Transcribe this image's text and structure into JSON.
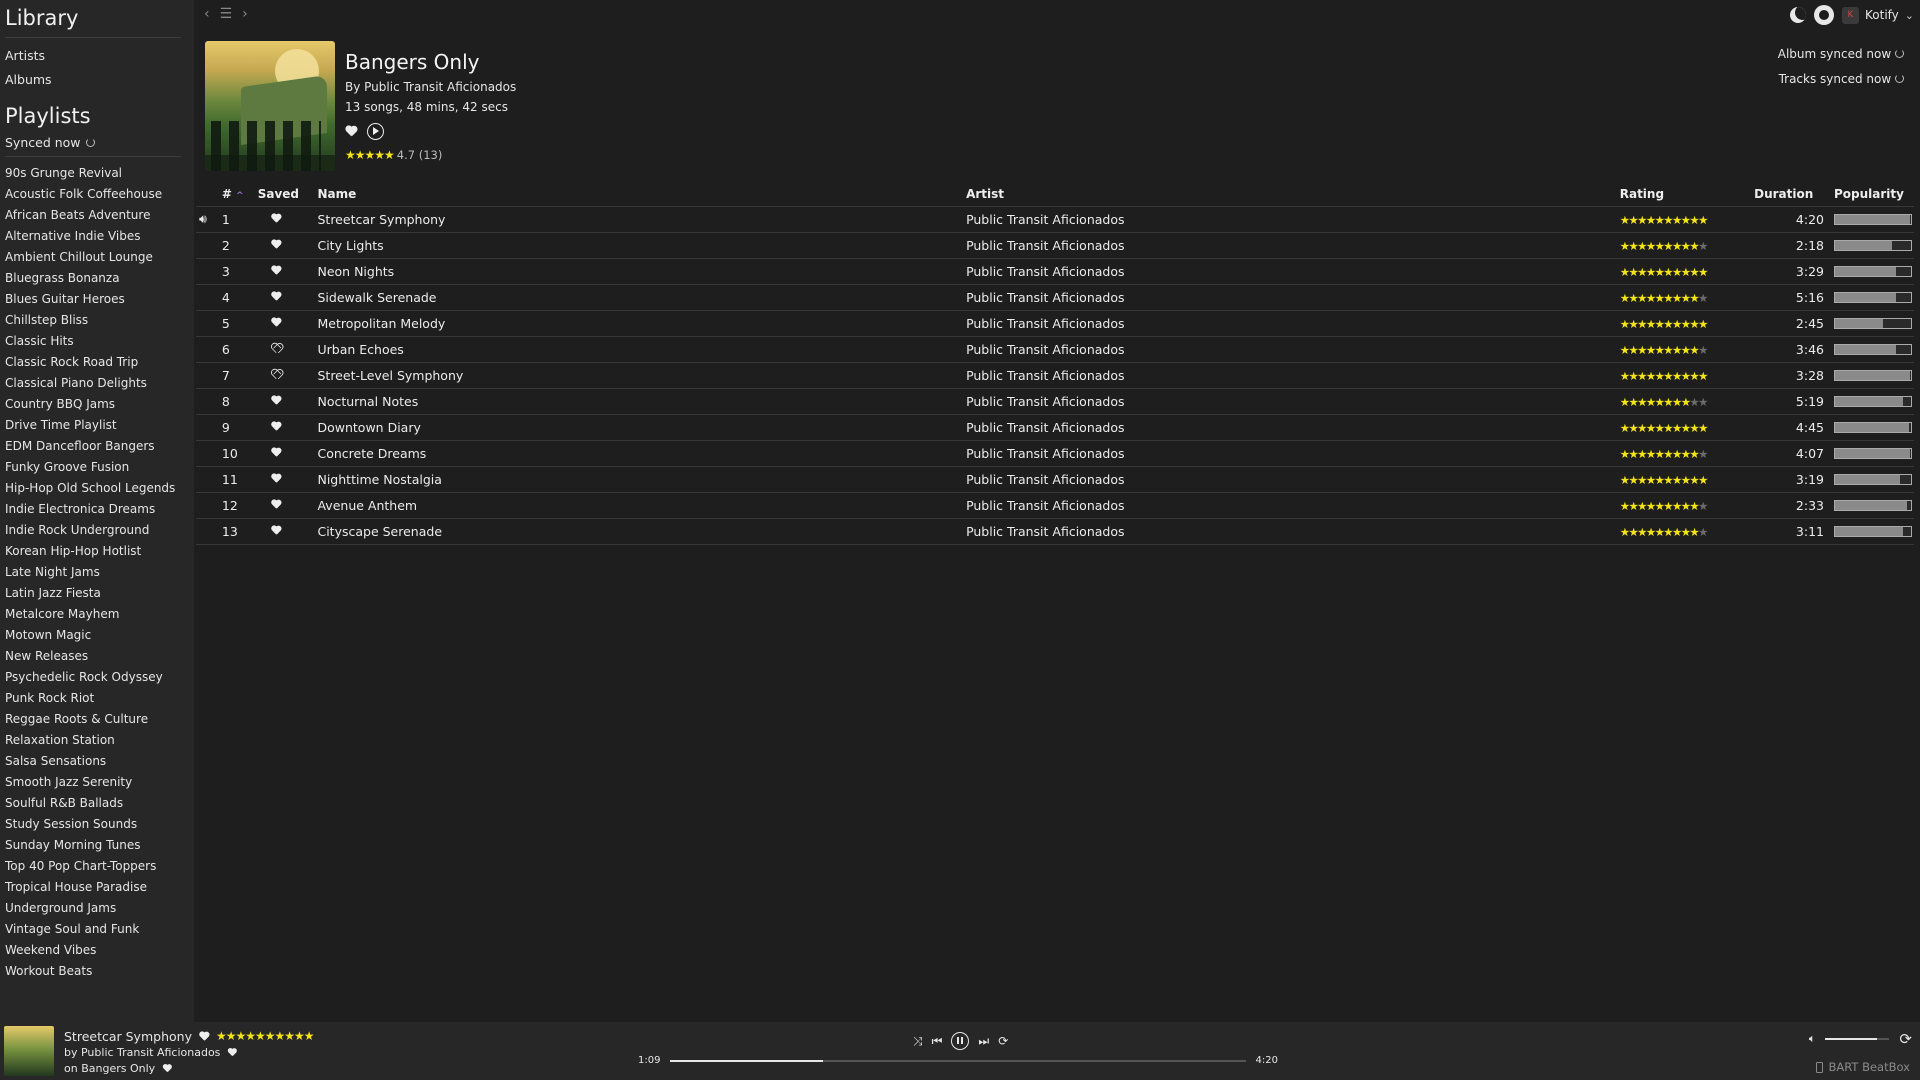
{
  "sidebar": {
    "library_title": "Library",
    "library_links": [
      "Artists",
      "Albums"
    ],
    "playlists_title": "Playlists",
    "synced_label": "Synced now",
    "playlists": [
      "90s Grunge Revival",
      "Acoustic Folk Coffeehouse",
      "African Beats Adventure",
      "Alternative Indie Vibes",
      "Ambient Chillout Lounge",
      "Bluegrass Bonanza",
      "Blues Guitar Heroes",
      "Chillstep Bliss",
      "Classic Hits",
      "Classic Rock Road Trip",
      "Classical Piano Delights",
      "Country BBQ Jams",
      "Drive Time Playlist",
      "EDM Dancefloor Bangers",
      "Funky Groove Fusion",
      "Hip-Hop Old School Legends",
      "Indie Electronica Dreams",
      "Indie Rock Underground",
      "Korean Hip-Hop Hotlist",
      "Late Night Jams",
      "Latin Jazz Fiesta",
      "Metalcore Mayhem",
      "Motown Magic",
      "New Releases",
      "Psychedelic Rock Odyssey",
      "Punk Rock Riot",
      "Reggae Roots & Culture",
      "Relaxation Station",
      "Salsa Sensations",
      "Smooth Jazz Serenity",
      "Soulful R&B Ballads",
      "Study Session Sounds",
      "Sunday Morning Tunes",
      "Top 40 Pop Chart-Toppers",
      "Tropical House Paradise",
      "Underground Jams",
      "Vintage Soul and Funk",
      "Weekend Vibes",
      "Workout Beats"
    ]
  },
  "topbar": {
    "user_name": "Kotify",
    "user_initial": "K"
  },
  "sync": {
    "album": "Album synced now",
    "tracks": "Tracks synced now"
  },
  "album": {
    "title": "Bangers Only",
    "by": "By Public Transit Aficionados",
    "meta": "13 songs, 48 mins, 42 secs",
    "rating_stars": "★★★★★",
    "rating_text": "4.7 (13)"
  },
  "table": {
    "headers": {
      "num": "#",
      "saved": "Saved",
      "name": "Name",
      "artist": "Artist",
      "rating": "Rating",
      "duration": "Duration",
      "popularity": "Popularity"
    },
    "tracks": [
      {
        "num": "1",
        "saved": true,
        "name": "Streetcar Symphony",
        "artist": "Public Transit Aficionados",
        "stars": 10,
        "duration": "4:20",
        "popularity": 0.99,
        "playing": true
      },
      {
        "num": "2",
        "saved": true,
        "name": "City Lights",
        "artist": "Public Transit Aficionados",
        "stars": 9,
        "duration": "2:18",
        "popularity": 0.75
      },
      {
        "num": "3",
        "saved": true,
        "name": "Neon Nights",
        "artist": "Public Transit Aficionados",
        "stars": 10,
        "duration": "3:29",
        "popularity": 0.8
      },
      {
        "num": "4",
        "saved": true,
        "name": "Sidewalk Serenade",
        "artist": "Public Transit Aficionados",
        "stars": 9,
        "duration": "5:16",
        "popularity": 0.8
      },
      {
        "num": "5",
        "saved": true,
        "name": "Metropolitan Melody",
        "artist": "Public Transit Aficionados",
        "stars": 10,
        "duration": "2:45",
        "popularity": 0.63
      },
      {
        "num": "6",
        "saved": false,
        "name": "Urban Echoes",
        "artist": "Public Transit Aficionados",
        "stars": 9,
        "duration": "3:46",
        "popularity": 0.8
      },
      {
        "num": "7",
        "saved": false,
        "name": "Street-Level Symphony",
        "artist": "Public Transit Aficionados",
        "stars": 10,
        "duration": "3:28",
        "popularity": 0.99
      },
      {
        "num": "8",
        "saved": true,
        "name": "Nocturnal Notes",
        "artist": "Public Transit Aficionados",
        "stars": 8,
        "duration": "5:19",
        "popularity": 0.9
      },
      {
        "num": "9",
        "saved": true,
        "name": "Downtown Diary",
        "artist": "Public Transit Aficionados",
        "stars": 10,
        "duration": "4:45",
        "popularity": 0.97
      },
      {
        "num": "10",
        "saved": true,
        "name": "Concrete Dreams",
        "artist": "Public Transit Aficionados",
        "stars": 9,
        "duration": "4:07",
        "popularity": 0.99
      },
      {
        "num": "11",
        "saved": true,
        "name": "Nighttime Nostalgia",
        "artist": "Public Transit Aficionados",
        "stars": 10,
        "duration": "3:19",
        "popularity": 0.85
      },
      {
        "num": "12",
        "saved": true,
        "name": "Avenue Anthem",
        "artist": "Public Transit Aficionados",
        "stars": 9,
        "duration": "2:33",
        "popularity": 0.95
      },
      {
        "num": "13",
        "saved": true,
        "name": "Cityscape Serenade",
        "artist": "Public Transit Aficionados",
        "stars": 9,
        "duration": "3:11",
        "popularity": 0.9
      }
    ]
  },
  "player": {
    "title": "Streetcar Symphony",
    "stars": "★★★★★★★★★★",
    "artist_line": "by Public Transit Aficionados",
    "album_line": "on Bangers Only",
    "elapsed": "1:09",
    "total": "4:20",
    "progress": 0.265,
    "volume": 0.8,
    "device": "BART BeatBox"
  },
  "colors": {
    "star": "#f2e31a",
    "accent_purple": "#9b6fd6",
    "background": "#1e1e1e",
    "sidebar": "#272727"
  }
}
